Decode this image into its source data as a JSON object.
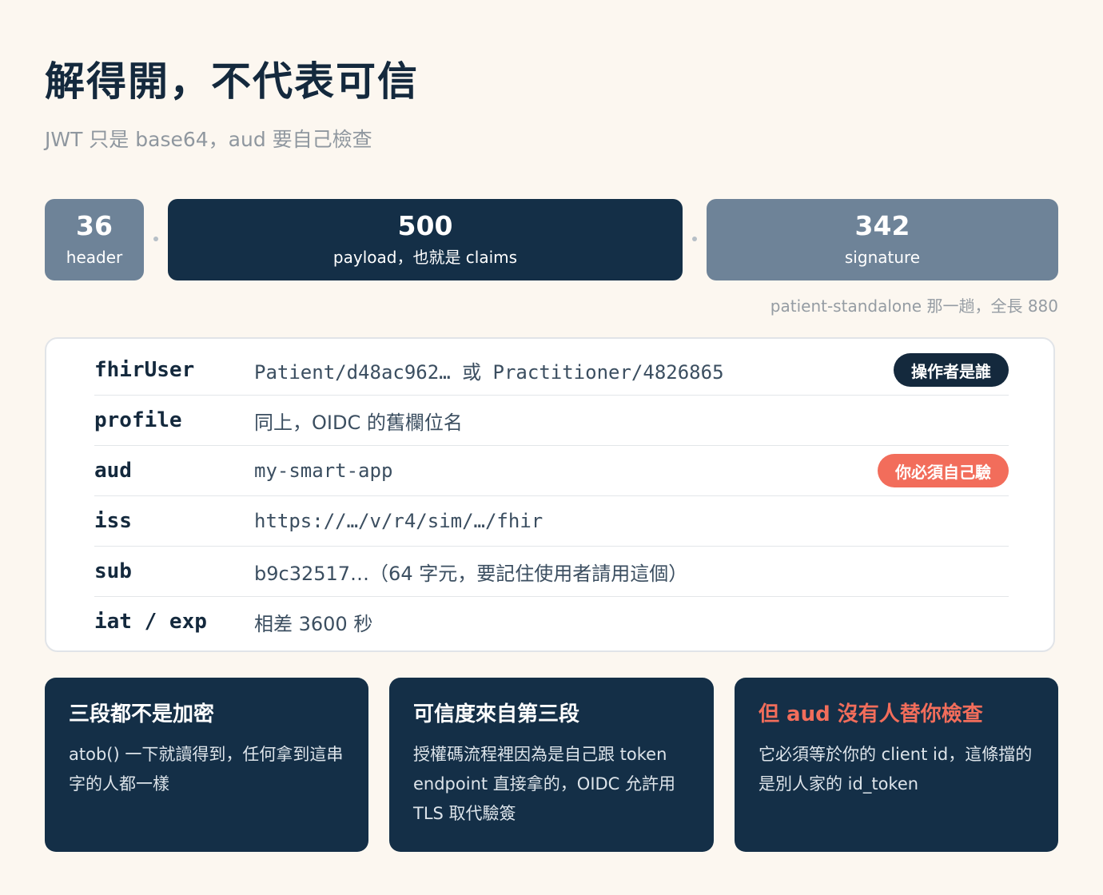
{
  "header": {
    "title": "解得開，不代表可信",
    "subtitle": "JWT 只是 base64，aud 要自己檢查"
  },
  "segments": [
    {
      "value": "36",
      "label": "header"
    },
    {
      "value": "500",
      "label": "payload，也就是 claims"
    },
    {
      "value": "342",
      "label": "signature"
    }
  ],
  "length_note": "patient-standalone 那一趟，全長 880",
  "claims": [
    {
      "key": "fhirUser",
      "value": "Patient/d48ac962… 或 Practitioner/4826865",
      "badge": "操作者是誰"
    },
    {
      "key": "profile",
      "value": "同上，OIDC 的舊欄位名"
    },
    {
      "key": "aud",
      "value": "my-smart-app",
      "badge": "你必須自己驗"
    },
    {
      "key": "iss",
      "value": "https://…/v/r4/sim/…/fhir"
    },
    {
      "key": "sub",
      "value": "b9c32517…（64 字元，要記住使用者請用這個）"
    },
    {
      "key": "iat / exp",
      "value": "相差 3600 秒"
    }
  ],
  "cards": [
    {
      "title": "三段都不是加密",
      "body": "atob() 一下就讀得到，任何拿到這串字的人都一樣"
    },
    {
      "title": "可信度來自第三段",
      "body": "授權碼流程裡因為是自己跟 token endpoint 直接拿的，OIDC 允許用 TLS 取代驗簽"
    },
    {
      "title": "但 aud 沒有人替你檢查",
      "body": "它必須等於你的 client id，這條擋的是別人家的 id_token"
    }
  ],
  "colors": {
    "background": "#fcf7f0",
    "navy": "#142f47",
    "slate": "#6e8398",
    "coral": "#f26d5b"
  }
}
